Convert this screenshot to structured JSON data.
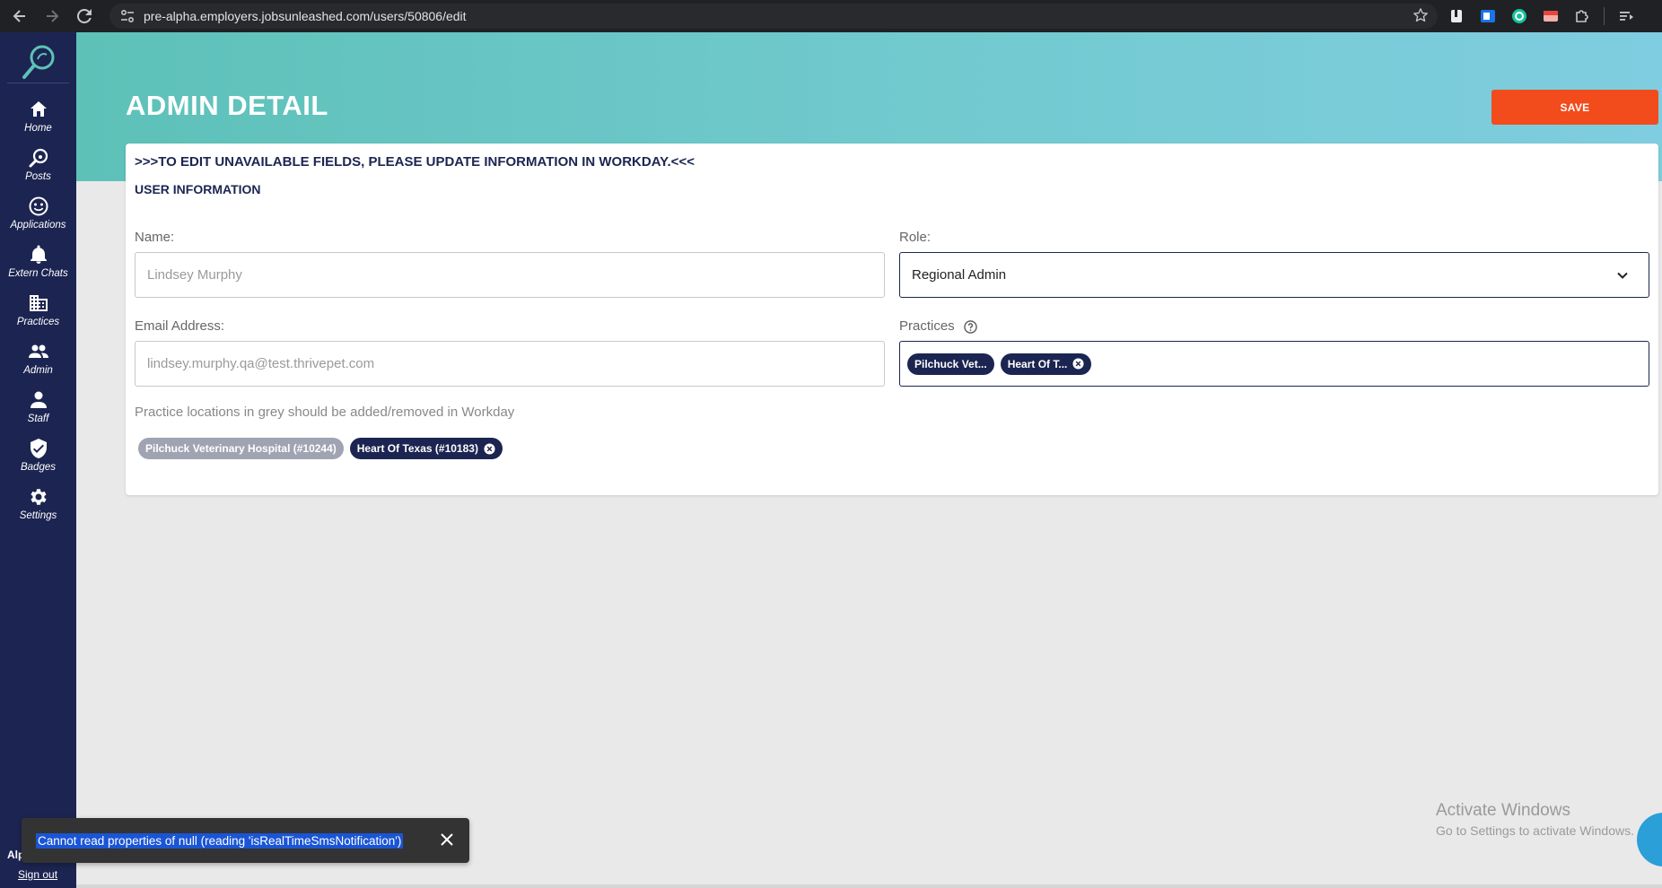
{
  "browser": {
    "url": "pre-alpha.employers.jobsunleashed.com/users/50806/edit"
  },
  "sidebar": {
    "items": [
      {
        "label": "Home",
        "icon": "home-icon"
      },
      {
        "label": "Posts",
        "icon": "magnifier-paw-icon"
      },
      {
        "label": "Applications",
        "icon": "smiley-icon"
      },
      {
        "label": "Extern Chats",
        "icon": "bell-icon"
      },
      {
        "label": "Practices",
        "icon": "building-icon"
      },
      {
        "label": "Admin",
        "icon": "people-icon"
      },
      {
        "label": "Staff",
        "icon": "person-icon"
      },
      {
        "label": "Badges",
        "icon": "shield-check-icon"
      },
      {
        "label": "Settings",
        "icon": "gear-icon"
      }
    ],
    "user_label": "Alp",
    "signout": "Sign out"
  },
  "page": {
    "title": "ADMIN DETAIL",
    "save_label": "SAVE"
  },
  "card": {
    "notice": ">>>TO EDIT UNAVAILABLE FIELDS, PLEASE UPDATE INFORMATION IN WORKDAY.<<<",
    "section_title": "USER INFORMATION",
    "name": {
      "label": "Name:",
      "value": "Lindsey Murphy"
    },
    "role": {
      "label": "Role:",
      "value": "Regional Admin"
    },
    "email": {
      "label": "Email Address:",
      "value": "lindsey.murphy.qa@test.thrivepet.com"
    },
    "practices": {
      "label": "Practices",
      "chips": [
        "Pilchuck Vet...",
        "Heart Of T..."
      ]
    },
    "hint": "Practice locations in grey should be added/removed in Workday",
    "location_chips": [
      {
        "label": "Pilchuck Veterinary Hospital (#10244)",
        "grey": true
      },
      {
        "label": "Heart Of Texas (#10183)",
        "grey": false
      }
    ]
  },
  "toast": {
    "message": "Cannot read properties of null (reading 'isRealTimeSmsNotification')"
  },
  "watermark": {
    "line1": "Activate Windows",
    "line2": "Go to Settings to activate Windows."
  },
  "colors": {
    "sidebar": "#1c2551",
    "save": "#f24b1c",
    "banner_start": "#5dc1b8",
    "banner_end": "#7fcde0"
  }
}
